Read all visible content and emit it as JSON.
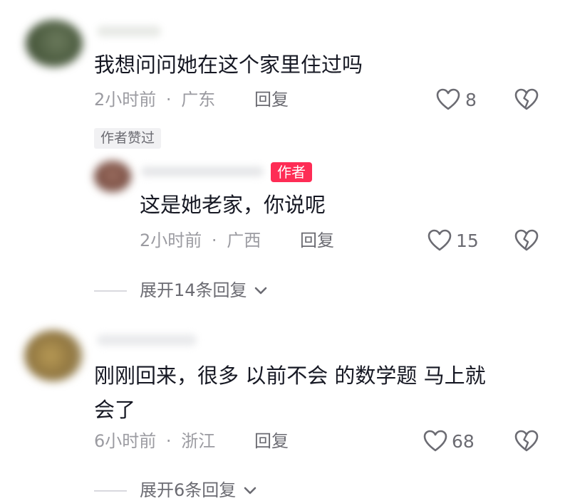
{
  "comments": [
    {
      "text": "我想问问她在这个家里住过吗",
      "time": "2小时前",
      "location": "广东",
      "reply_label": "回复",
      "likes": "8",
      "badge": "作者赞过",
      "avatar_color": "#55654a"
    },
    {
      "text_lines": [
        "刚刚回来，很多 以前不会 的数学题 马上就",
        "会了"
      ],
      "time": "6小时前",
      "location": "浙江",
      "reply_label": "回复",
      "likes": "68",
      "avatar_color": "#a6884a"
    }
  ],
  "reply": {
    "author_tag": "作者",
    "text": "这是她老家，你说呢",
    "time": "2小时前",
    "location": "广西",
    "reply_label": "回复",
    "likes": "15",
    "avatar_color": "#8b5c50"
  },
  "expand": [
    {
      "label": "展开14条回复"
    },
    {
      "label": "展开6条回复"
    }
  ],
  "meta_separator": "·",
  "colors": {
    "author_tag_bg": "#fe2c55",
    "meta_gray": "#9b9ba1",
    "text_dark": "#161823"
  },
  "icons": [
    "heart-icon",
    "broken-heart-icon",
    "chevron-down-icon"
  ]
}
